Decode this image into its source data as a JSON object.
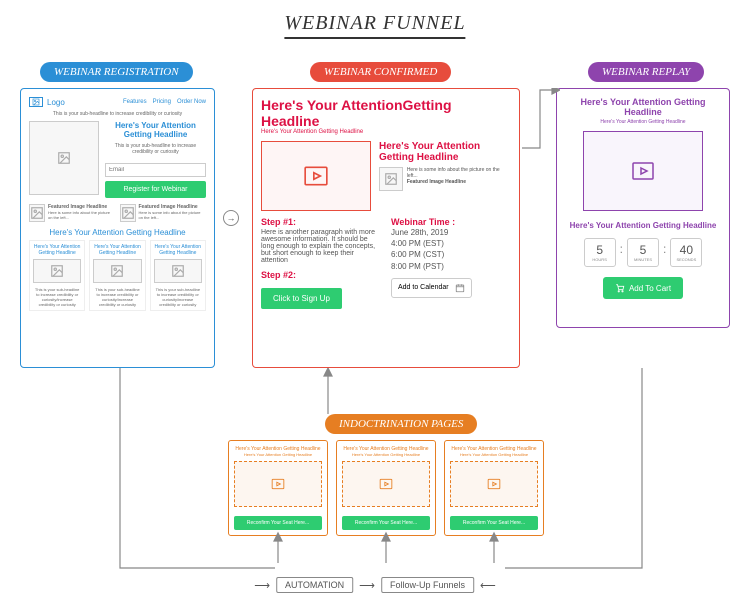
{
  "title": "WEBINAR FUNNEL",
  "tags": {
    "registration": "WEBINAR REGISTRATION",
    "confirmed": "WEBINAR CONFIRMED",
    "replay": "WEBINAR REPLAY",
    "indoctrination": "INDOCTRINATION PAGES"
  },
  "registration": {
    "logo": "Logo",
    "nav": [
      "Features",
      "Pricing",
      "Order Now"
    ],
    "subhead": "This is your sub-headline to increase credibility or curiosity",
    "headline": "Here's Your Attention Getting Headline",
    "subhead2": "This is your sub-headline to increase credibility or curiosity",
    "email_placeholder": "Email",
    "cta": "Register for Webinar",
    "feature_title": "Featured Image Headline",
    "feature_text": "Here is some info about the picture on the left...",
    "section_head": "Here's Your Attention Getting Headline",
    "mini_head": "Here's Your Attention Getting Headline",
    "footer_sub": "This is your sub-headline to increase credibility or curiosity/increase credibility or curiosity"
  },
  "confirmed": {
    "headline": "Here's Your AttentionGetting Headline",
    "subhead": "Here's Your Attention Getting Headline",
    "side_headline": "Here's Your Attention Getting Headline",
    "side_text": "Here is some info about the picture on the left...",
    "side_title": "Featured Image Headline",
    "step1": "Step #1:",
    "paragraph": "Here is another paragraph with more awesome information. It should be long enough to explain the concepts, but short enough to keep their attention",
    "step2": "Step #2:",
    "webinar_time_label": "Webinar Time :",
    "date": "June 28th, 2019",
    "times": [
      "4:00 PM (EST)",
      "6:00 PM (CST)",
      "8:00 PM (PST)"
    ],
    "calendar": "Add to Calendar",
    "cta": "Click to Sign Up"
  },
  "replay": {
    "headline": "Here's Your Attention Getting Headline",
    "subhead": "Here's Your Attention Getting Headline",
    "headline2": "Here's Your Attention Getting Headline",
    "countdown": [
      {
        "num": "5",
        "label": "HOURS"
      },
      {
        "num": "5",
        "label": "MINUTES"
      },
      {
        "num": "40",
        "label": "SECONDS"
      }
    ],
    "cta": "Add To Cart"
  },
  "indoctrination": {
    "head": "Here's Your Attention Getting Headline",
    "sub": "Here's Your Attention Getting Headline",
    "cta": "Reconfirm Your Seat Here..."
  },
  "flow": {
    "automation": "AUTOMATION",
    "followup": "Follow-Up Funnels"
  }
}
